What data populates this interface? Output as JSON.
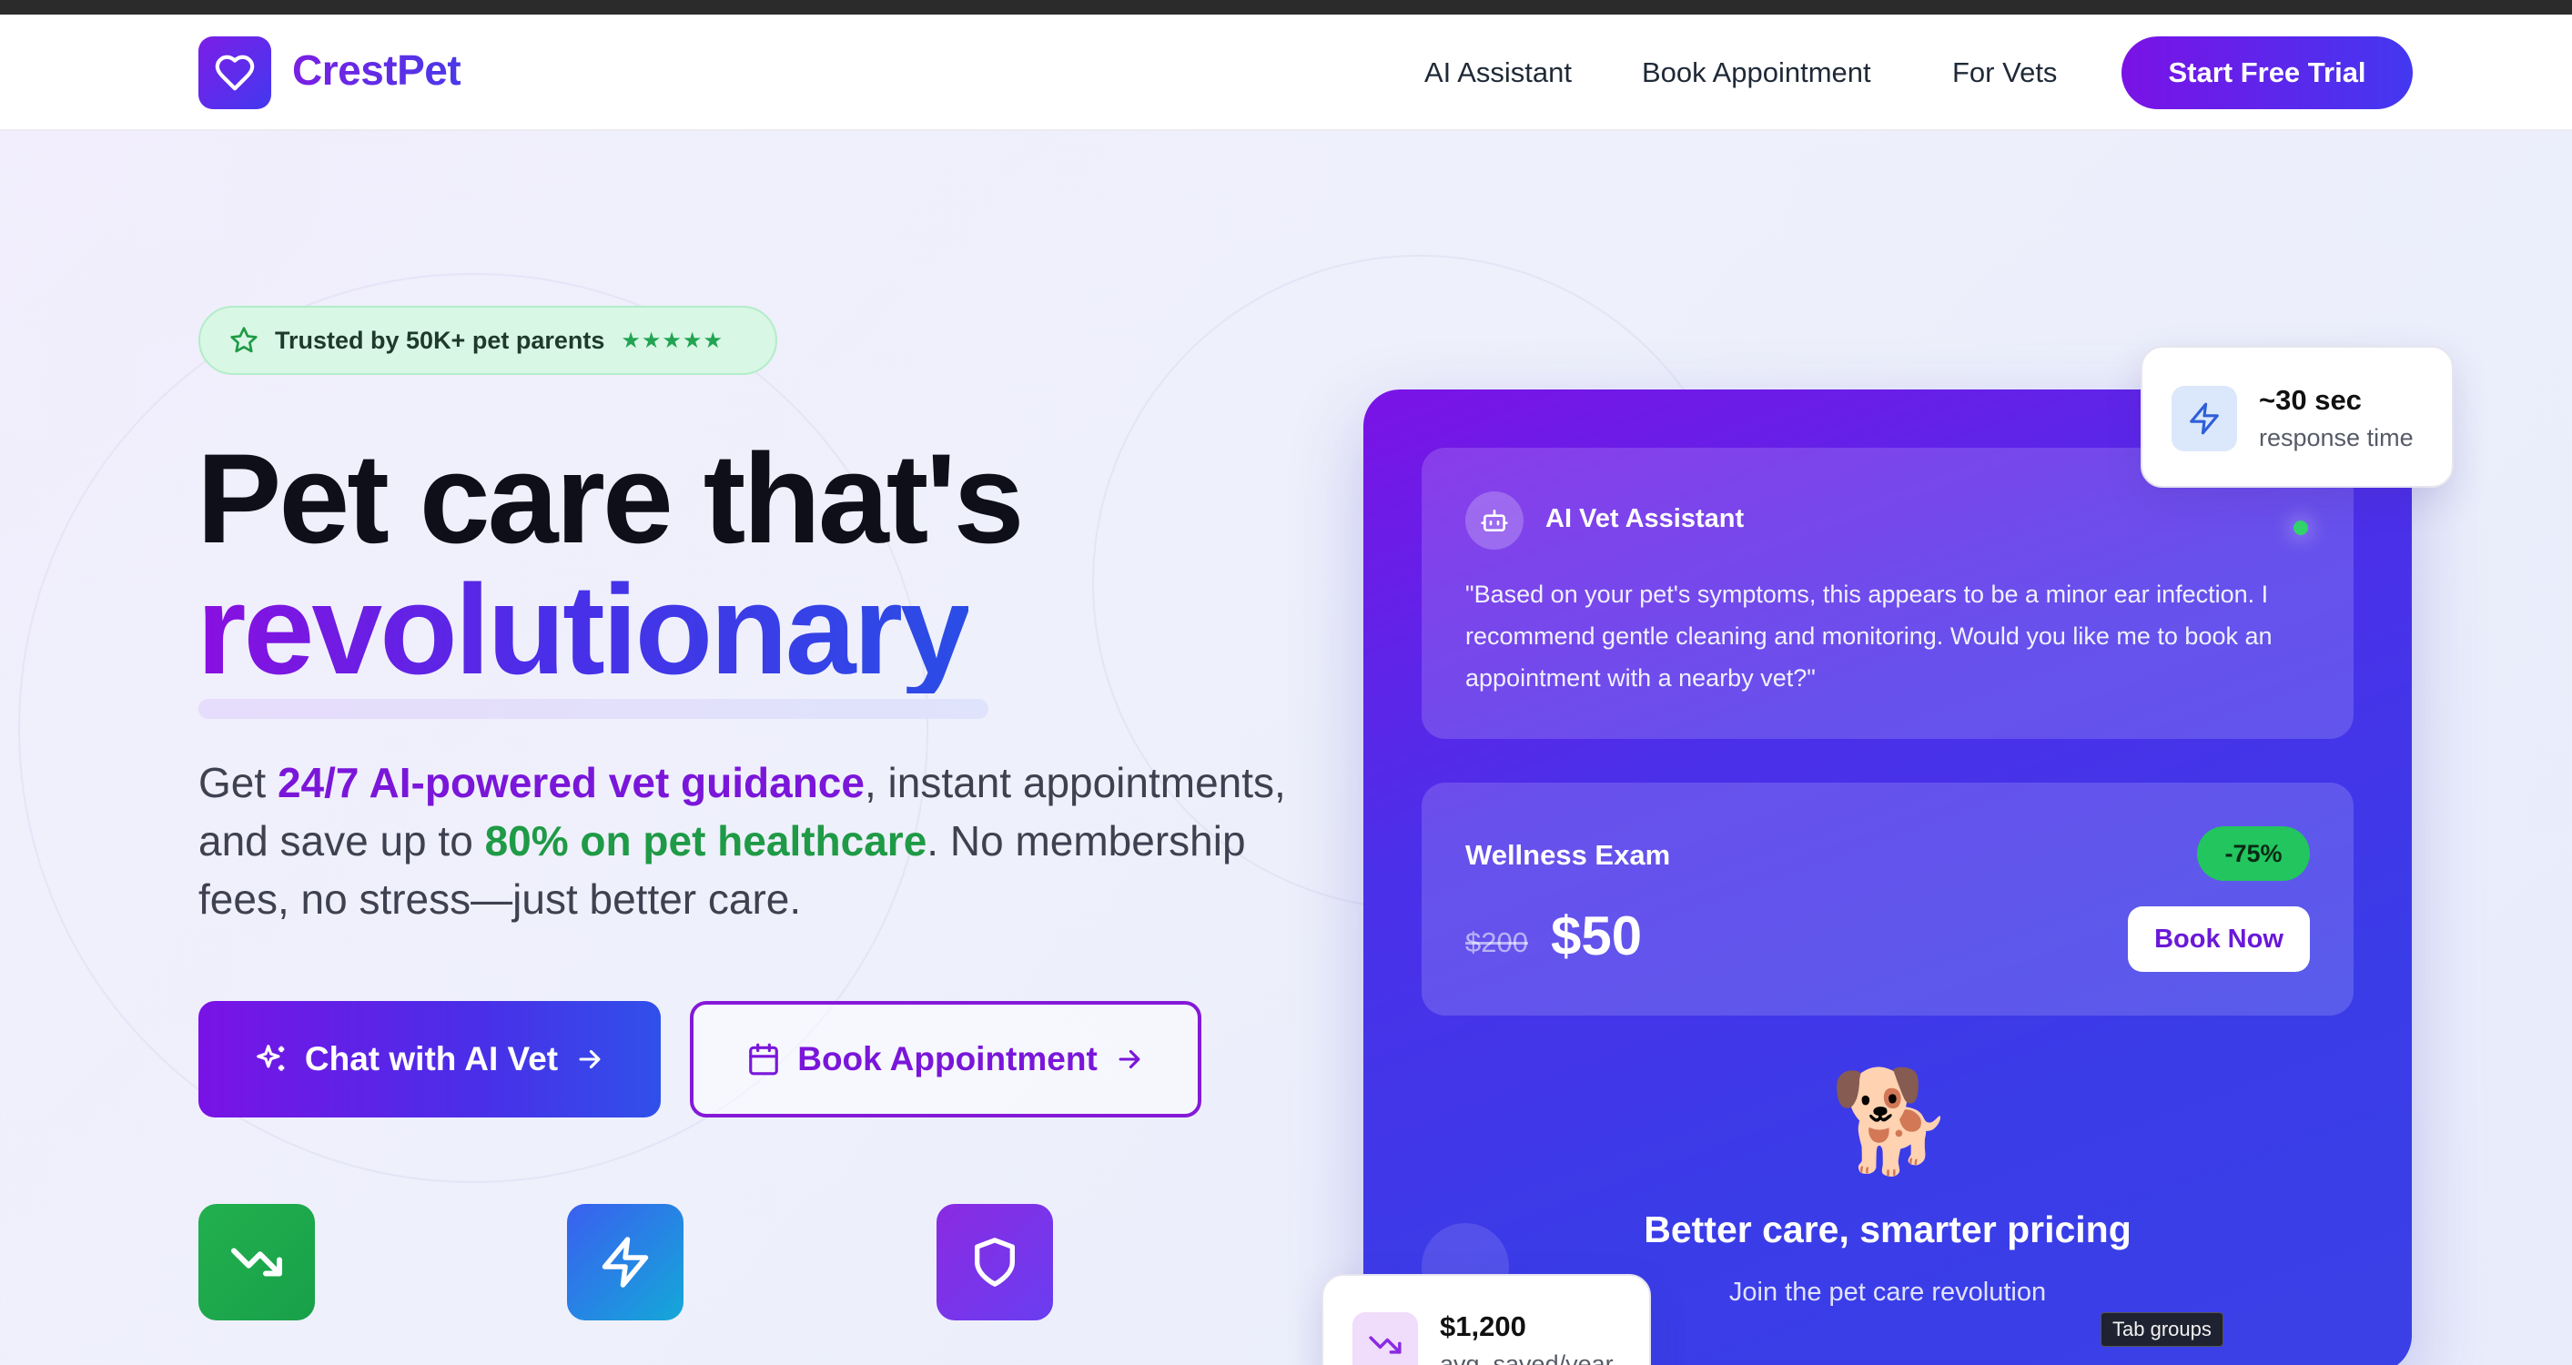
{
  "brand": {
    "name": "CrestPet",
    "accent": "#6a22e0",
    "green": "#1f9a46"
  },
  "nav": {
    "links": [
      "AI Assistant",
      "Book Appointment",
      "For Vets"
    ],
    "cta": "Start Free Trial"
  },
  "hero": {
    "badge": "Trusted by 50K+ pet parents",
    "badge_stars": "★★★★★",
    "title_line1": "Pet care that's",
    "title_line2": "revolutionary",
    "sub_pre": "Get ",
    "sub_hl1": "24/7 AI-powered vet guidance",
    "sub_mid": ", instant appointments, and save up to ",
    "sub_hl2": "80% on pet healthcare",
    "sub_post": ". No membership fees, no stress—just better care.",
    "btn_primary": "Chat with AI Vet",
    "btn_secondary": "Book Appointment"
  },
  "features": [
    {
      "icon": "trending-down-icon",
      "color": "#22b04e"
    },
    {
      "icon": "zap-icon",
      "color": "#2f6be0"
    },
    {
      "icon": "shield-icon",
      "color": "#7b36e6"
    }
  ],
  "card": {
    "chat_title": "AI Vet Assistant",
    "chat_message": "\"Based on your pet's symptoms, this appears to be a minor ear infection. I recommend gentle cleaning and monitoring. Would you like me to book an appointment with a nearby vet?\"",
    "price_title": "Wellness Exam",
    "discount": "-75%",
    "old_price": "$200",
    "new_price": "$50",
    "book_now": "Book Now",
    "emoji": "🐕",
    "tagline": "Better care, smarter pricing",
    "subline": "Join the pet care revolution"
  },
  "floats": {
    "response_value": "~30 sec",
    "response_label": "response time",
    "savings_value": "$1,200",
    "savings_label": "avg. saved/year"
  },
  "tooltip": "Tab groups"
}
